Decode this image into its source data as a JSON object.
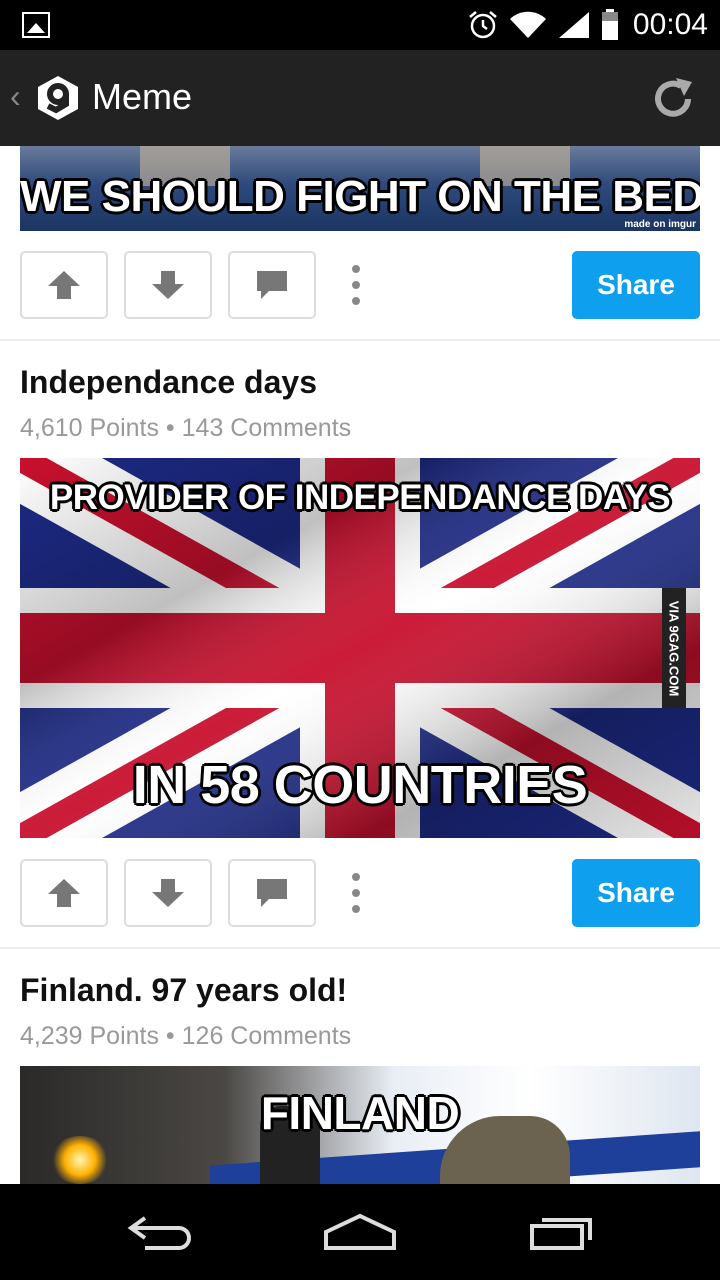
{
  "status_bar": {
    "time": "00:04",
    "icons": [
      "image-notification-icon",
      "alarm-icon",
      "wifi-icon",
      "signal-icon",
      "battery-icon"
    ]
  },
  "action_bar": {
    "back_glyph": "‹",
    "app_logo": "9gag-logo",
    "title": "Meme",
    "refresh_icon": "refresh-icon"
  },
  "colors": {
    "status_bar_bg": "#000000",
    "action_bar_bg": "#222222",
    "share_button": "#0EA0EE",
    "meta_text": "#999999"
  },
  "posts": [
    {
      "image_caption": "WE SHOULD FIGHT ON THE BED",
      "image_watermark": "made on imgur",
      "share_label": "Share"
    },
    {
      "title": "Independance days",
      "meta": "4,610 Points • 143 Comments",
      "image_caption_top": "PROVIDER OF INDEPENDANCE DAYS",
      "image_caption_bottom": "IN 58 COUNTRIES",
      "image_watermark": "VIA 9GAG.COM",
      "share_label": "Share"
    },
    {
      "title": "Finland. 97 years old!",
      "meta": "4,239 Points • 126 Comments",
      "image_caption_top": "FINLAND"
    }
  ],
  "nav_bar": {
    "buttons": [
      "back-icon",
      "home-icon",
      "recents-icon"
    ]
  }
}
